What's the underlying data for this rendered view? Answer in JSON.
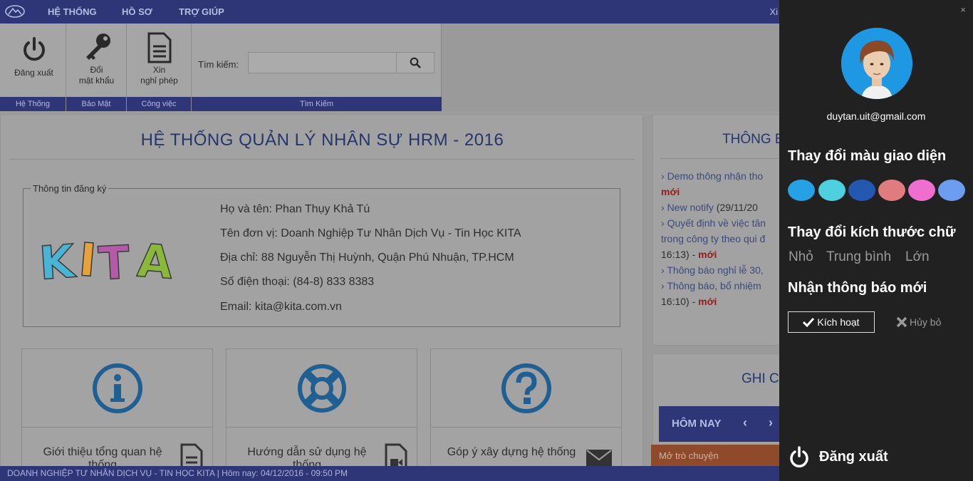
{
  "menu": {
    "items": [
      "HỆ THỐNG",
      "HỒ SƠ",
      "TRỢ GIÚP"
    ],
    "right_text": "Xi"
  },
  "ribbon": {
    "logout_label": "Đăng xuất",
    "password_label": "Đổi\nmật khẩu",
    "leave_label": "Xin\nnghỉ phép",
    "groups": [
      "Hệ Thống",
      "Bảo Mật",
      "Công việc",
      "Tìm Kiếm"
    ],
    "search_label": "Tìm kiếm:",
    "search_value": ""
  },
  "main": {
    "title": "HỆ THỐNG QUẢN LÝ NHÂN SỰ HRM - 2016",
    "legend": "Thông tin đăng ký",
    "logo_text": "KITA",
    "info": [
      "Họ và tên: Phan Thụy Khả Tú",
      "Tên đơn vị: Doanh Nghiệp Tư Nhân Dịch Vụ - Tin Học KITA",
      "Địa chỉ: 88 Nguyễn Thị Huỳnh, Quận Phú Nhuận, TP.HCM",
      "Số điện thoại: (84-8) 833 8383",
      "Email: kita@kita.com.vn"
    ],
    "cards": [
      "Giới thiệu tổng quan hệ thống",
      "Hướng dẫn sử dụng hệ thống",
      "Góp ý xây dựng hệ thống"
    ]
  },
  "notifications": {
    "title": "THÔNG B",
    "items": [
      {
        "text": "Demo thông nhận tho",
        "date": ""
      },
      {
        "new": "mới"
      },
      {
        "text": "New notify",
        "date": " (29/11/20"
      },
      {
        "text": "Quyết định về việc tăn",
        "date": ""
      },
      {
        "plain": "trong công ty theo qui đ"
      },
      {
        "plain": "16:13) - ",
        "new": "mới"
      },
      {
        "text": "Thông báo nghỉ lễ 30,",
        "date": ""
      },
      {
        "text": "Thông báo, bổ nhiệm",
        "date": ""
      },
      {
        "plain": "16:10) - ",
        "new": "mới"
      }
    ]
  },
  "notes": {
    "title": "GHI C",
    "today": "HÔM NAY",
    "prev": "‹",
    "next": "›"
  },
  "chat": {
    "label": "Mở trò chuyện"
  },
  "status": {
    "text": "DOANH NGHIỆP TƯ NHÂN DỊCH VỤ - TIN HỌC KITA | Hôm nay: 04/12/2016 - 09:50 PM"
  },
  "panel": {
    "close": "×",
    "email": "duytan.uit@gmail.com",
    "theme_title": "Thay đổi màu giao diện",
    "swatches": [
      "#27a1e6",
      "#4fd0e0",
      "#2458b0",
      "#e07b80",
      "#ee6fd0",
      "#6c9df0"
    ],
    "font_title": "Thay đổi kích thước chữ",
    "sizes": [
      "Nhỏ",
      "Trung bình",
      "Lớn"
    ],
    "notify_title": "Nhận thông báo mới",
    "activate": "Kích hoạt",
    "cancel": "Hủy bỏ",
    "logout": "Đăng xuất"
  }
}
